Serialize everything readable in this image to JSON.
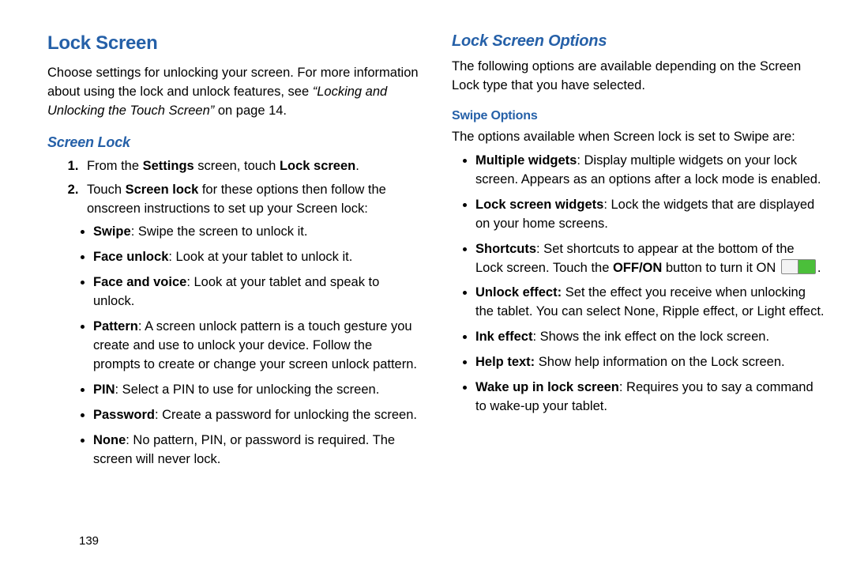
{
  "page_number": "139",
  "left": {
    "title": "Lock Screen",
    "intro_a": "Choose settings for unlocking your screen. For more information about using the lock and unlock features, see ",
    "intro_ref": "“Locking and Unlocking the Touch Screen”",
    "intro_b": " on page 14.",
    "screen_lock_heading": "Screen Lock",
    "step1_a": "From the ",
    "step1_b": "Settings",
    "step1_c": " screen, touch ",
    "step1_d": "Lock screen",
    "step1_e": ".",
    "step2_a": "Touch ",
    "step2_b": "Screen lock",
    "step2_c": " for these options then follow the onscreen instructions to set up your Screen lock:",
    "opts": [
      {
        "name": "Swipe",
        "desc": ": Swipe the screen to unlock it."
      },
      {
        "name": "Face unlock",
        "desc": ": Look at your tablet to unlock it."
      },
      {
        "name": "Face and voice",
        "desc": ": Look at your tablet and speak to unlock."
      },
      {
        "name": "Pattern",
        "desc": ": A screen unlock pattern is a touch gesture you create and use to unlock your device. Follow the prompts to create or change your screen unlock pattern."
      },
      {
        "name": "PIN",
        "desc": ": Select a PIN to use for unlocking the screen."
      },
      {
        "name": "Password",
        "desc": ": Create a password for unlocking the screen."
      },
      {
        "name": "None",
        "desc": ": No pattern, PIN, or password is required. The screen will never lock."
      }
    ]
  },
  "right": {
    "title": "Lock Screen Options",
    "intro": "The following options are available depending on the Screen Lock type that you have selected.",
    "swipe_heading": "Swipe Options",
    "swipe_intro": "The options available when Screen lock is set to Swipe are:",
    "opts": {
      "multiple_widgets_name": "Multiple widgets",
      "multiple_widgets_desc": ": Display multiple widgets on your lock screen. Appears as an options after a lock mode is enabled.",
      "lock_widgets_name": "Lock screen widgets",
      "lock_widgets_desc": ": Lock the widgets that are displayed on your home screens.",
      "shortcuts_name": "Shortcuts",
      "shortcuts_desc_a": ": Set shortcuts to appear at the bottom of the Lock screen. Touch the ",
      "shortcuts_offon": "OFF/ON",
      "shortcuts_desc_b": " button to turn it ON ",
      "shortcuts_desc_c": ".",
      "unlock_effect_name": "Unlock effect:",
      "unlock_effect_desc": " Set the effect you receive when unlocking the tablet. You can select None, Ripple effect, or Light effect.",
      "ink_effect_name": "Ink effect",
      "ink_effect_desc": ": Shows the ink effect on the lock screen.",
      "help_text_name": "Help text:",
      "help_text_desc": " Show help information on the Lock screen.",
      "wake_up_name": "Wake up in lock screen",
      "wake_up_desc": ": Requires you to say a command to wake-up your tablet."
    }
  }
}
